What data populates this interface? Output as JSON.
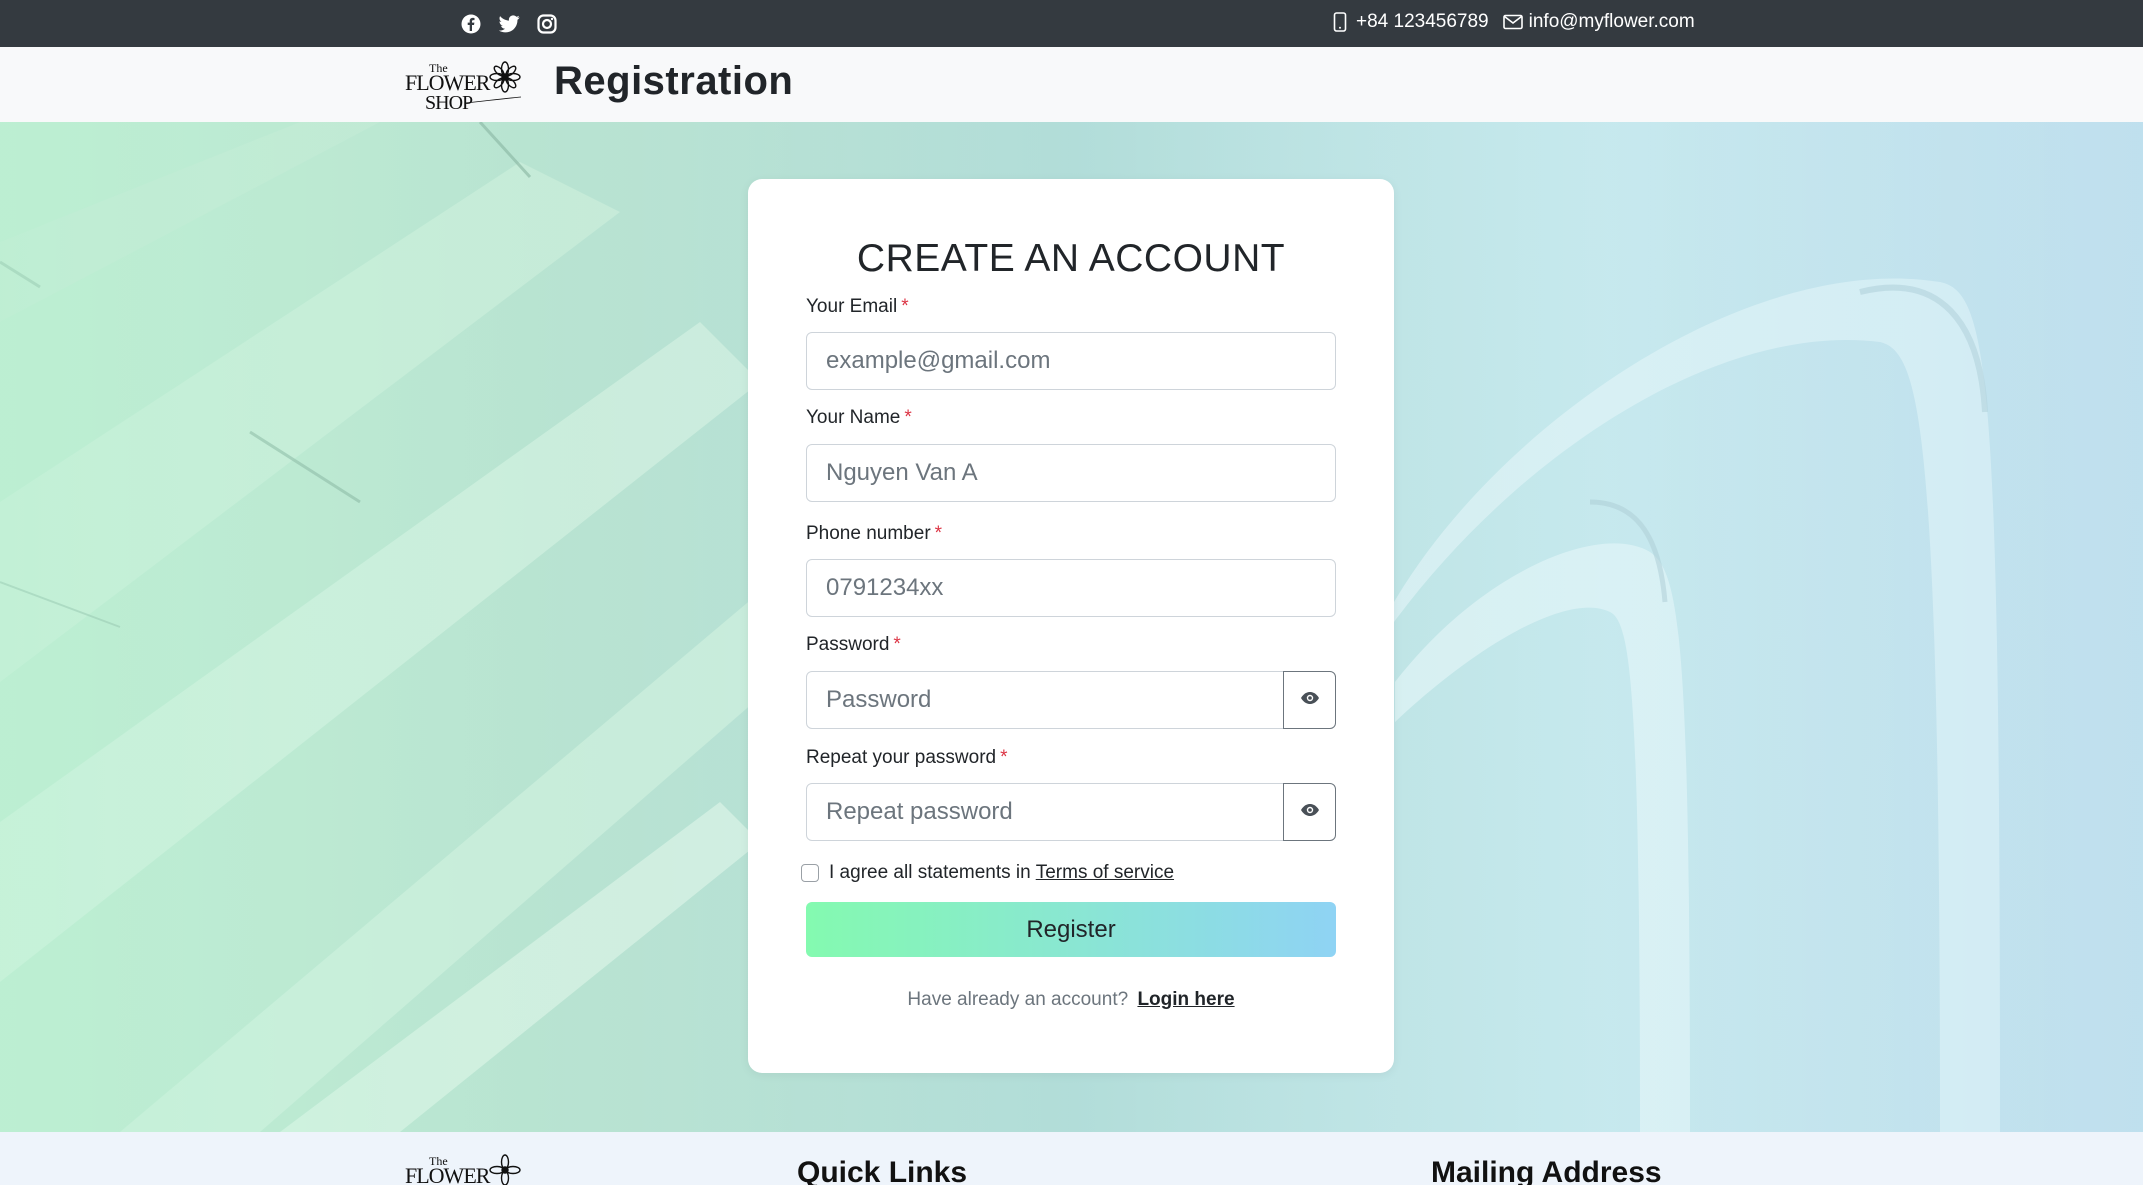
{
  "topbar": {
    "social": [
      "facebook-icon",
      "twitter-icon",
      "instagram-icon"
    ],
    "phone": "+84 123456789",
    "email": "info@myflower.com"
  },
  "header": {
    "logo_top": "The",
    "logo_main": "FLOWER",
    "logo_bottom": "SHOP",
    "title": "Registration"
  },
  "form": {
    "title": "CREATE AN ACCOUNT",
    "email_label": "Your Email",
    "email_placeholder": "example@gmail.com",
    "name_label": "Your Name",
    "name_placeholder": "Nguyen Van A",
    "phone_label": "Phone number",
    "phone_placeholder": "0791234xx",
    "password_label": "Password",
    "password_placeholder": "Password",
    "repeat_label": "Repeat your password",
    "repeat_placeholder": "Repeat password",
    "required_mark": "*",
    "agree_text": "I agree all statements in",
    "terms_link": "Terms of service",
    "register_button": "Register",
    "login_prompt": "Have already an account?",
    "login_link": "Login here"
  },
  "footer": {
    "quick_links_heading": "Quick Links",
    "mailing_heading": "Mailing Address"
  },
  "colors": {
    "topbar_bg": "#343a40",
    "required": "#dc3545",
    "button_gradient_start": "#84fab0",
    "button_gradient_end": "#8fd3f4"
  }
}
